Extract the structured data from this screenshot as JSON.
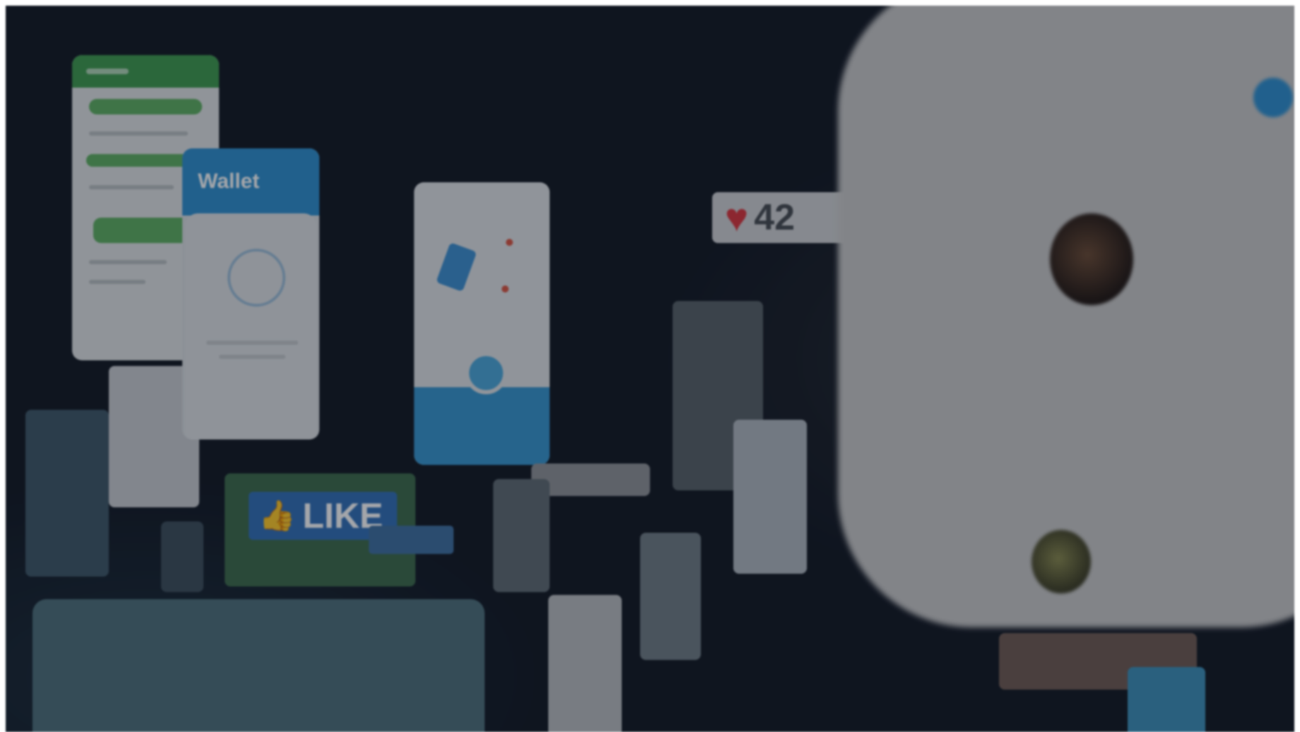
{
  "scene": {
    "wallet_title": "Wallet",
    "heart_count": "42",
    "like_label": "LIKE"
  },
  "colors": {
    "background": "#0f1520",
    "chat_green": "#3c9a4d",
    "wallet_blue": "#2d8fcf",
    "heart_red": "#d8323a",
    "like_blue": "#2f6fb6"
  },
  "icons": [
    "chat-app-icon",
    "fingerprint-icon",
    "heart-icon",
    "thumbs-up-icon",
    "twitter-icon"
  ]
}
